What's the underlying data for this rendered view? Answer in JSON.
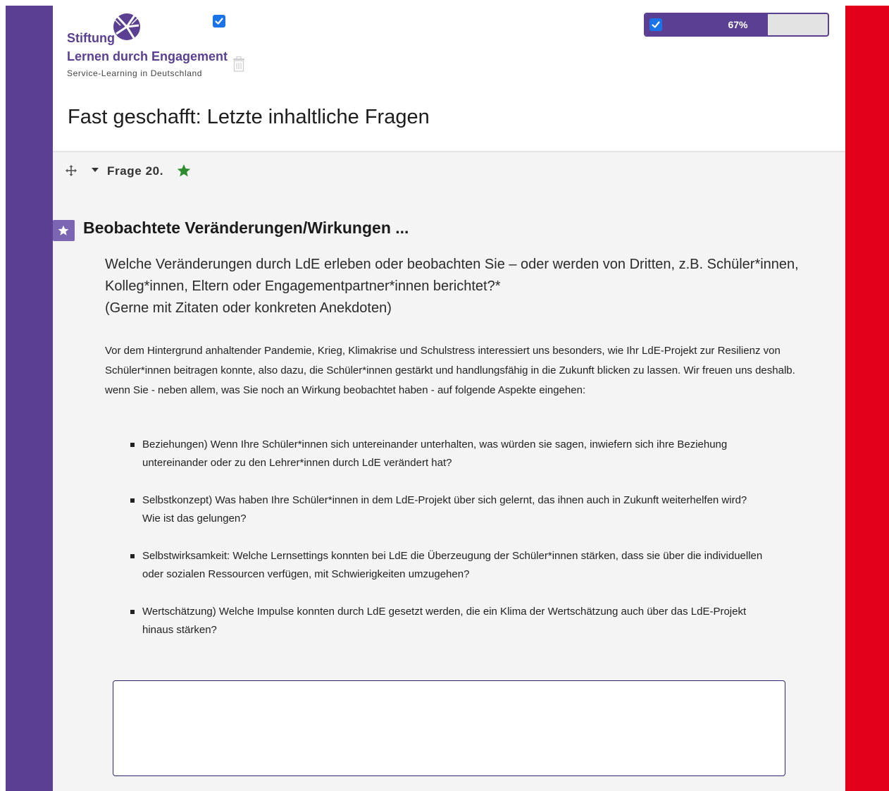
{
  "logo": {
    "line1": "Stiftung",
    "line2": "Lernen durch Engagement",
    "line3": "Service-Learning in Deutschland"
  },
  "progress": {
    "label": "67%",
    "value": 0.67
  },
  "page": {
    "title": "Fast geschafft: Letzte inhaltliche Fragen"
  },
  "question": {
    "number_label": "Frage 20.",
    "title": "Beobachtete Veränderungen/Wirkungen ...",
    "description": [
      "Welche Veränderungen durch LdE erleben oder beobachten Sie – oder werden von Dritten, z.B. Schüler*innen, Kolleg*innen, Eltern oder Engagementpartner*innen berichtet?*",
      "(Gerne mit Zitaten oder konkreten Anekdoten)"
    ],
    "body": "Vor dem Hintergrund anhaltender Pandemie, Krieg, Klimakrise und Schulstress interessiert uns besonders, wie Ihr LdE-Projekt zur Resilienz von Schüler*innen beitragen konnte, also dazu, die Schüler*innen gestärkt und handlungsfähig in die Zukunft blicken zu lassen. Wir freuen uns deshalb. wenn Sie - neben allem, was Sie noch an Wirkung beobachtet haben - auf folgende Aspekte eingehen:",
    "bullets": [
      "Beziehungen) Wenn Ihre Schüler*innen sich untereinander unterhalten, was würden sie sagen, inwiefern sich ihre Beziehung untereinander oder zu den Lehrer*innen durch LdE verändert hat?",
      "Selbstkonzept) Was haben Ihre Schüler*innen in dem LdE-Projekt über sich gelernt, das ihnen auch in Zukunft weiterhelfen wird? Wie ist das gelungen?",
      "Selbstwirksamkeit: Welche Lernsettings konnten bei LdE die Überzeugung der Schüler*innen stärken, dass sie über die individuellen oder sozialen Ressourcen verfügen, mit Schwierigkeiten umzugehen?",
      "Wertschätzung) Welche Impulse konnten durch LdE gesetzt werden, die ein Klima der Wertschätzung auch über das LdE-Projekt hinaus stärken?"
    ],
    "answer_value": ""
  },
  "colors": {
    "brand_purple": "#5b3f93",
    "brand_red": "#e2001a",
    "checkbox_blue": "#1a73e8",
    "star_green": "#2e8b2e"
  },
  "icons": [
    "logo-mark-icon",
    "checkbox-icon",
    "trash-icon",
    "move-icon",
    "caret-down-icon",
    "star-icon"
  ]
}
